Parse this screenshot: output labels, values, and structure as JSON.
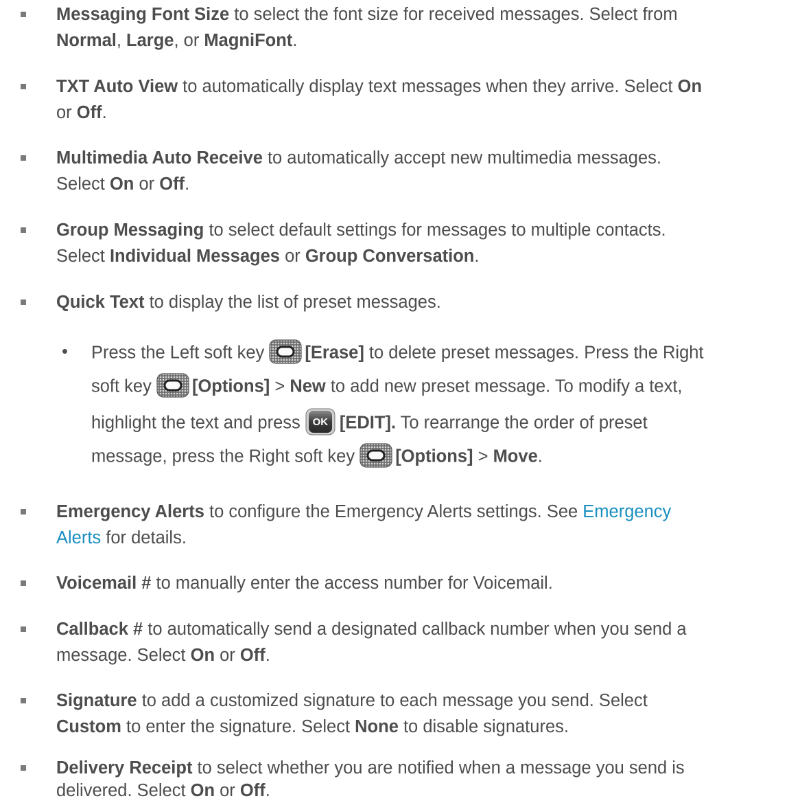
{
  "items": [
    {
      "title": "Messaging Font Size",
      "l1": " to select the font size for received messages. Select from",
      "l2a": "Normal",
      "l2b": ", ",
      "l2c": "Large",
      "l2d": ", or ",
      "l2e": "MagniFont",
      "l2f": "."
    },
    {
      "title": "TXT Auto View",
      "l1": " to automatically display text messages when they arrive. Select ",
      "l1b": "On",
      "l2a": "or ",
      "l2b": "Off",
      "l2c": "."
    },
    {
      "title": "Multimedia Auto Receive",
      "l1": " to automatically accept new multimedia messages.",
      "l2a": "Select ",
      "l2b": "On",
      "l2c": " or ",
      "l2d": "Off",
      "l2e": "."
    },
    {
      "title": "Group Messaging",
      "l1": " to select default settings for messages to multiple contacts.",
      "l2a": "Select ",
      "l2b": "Individual Messages",
      "l2c": " or ",
      "l2d": "Group Conversation",
      "l2e": "."
    },
    {
      "title": "Quick Text",
      "l1": " to display the list of preset messages."
    },
    {
      "title": "Emergency Alerts",
      "l1": " to configure the Emergency Alerts settings. See ",
      "link1": "Emergency",
      "link2": "Alerts",
      "l2": " for details."
    },
    {
      "title": "Voicemail #",
      "l1": " to manually enter the access number for Voicemail."
    },
    {
      "title": "Callback #",
      "l1": " to automatically send a designated callback number when you send a",
      "l2a": "message. Select ",
      "l2b": "On",
      "l2c": " or ",
      "l2d": "Off",
      "l2e": "."
    },
    {
      "title": "Signature",
      "l1": " to add a customized signature to each message you send. Select",
      "l2a": "Custom",
      "l2b": " to enter the signature. Select ",
      "l2c": "None",
      "l2d": " to disable signatures."
    },
    {
      "title": "Delivery Receipt",
      "l1": " to select whether you are notified when a message you send is",
      "l2a": "delivered. Select ",
      "l2b": "On",
      "l2c": " or ",
      "l2d": "Off",
      "l2e": "."
    }
  ],
  "quick_text_sub": {
    "bullet": "•",
    "s1a": "Press the Left soft key ",
    "s1b": "[Erase]",
    "s1c": " to delete preset messages. Press the Right",
    "s2a": "soft key ",
    "s2b": "[Options]",
    "s2c": " > ",
    "s2d": "New",
    "s2e": " to add new preset message. To modify a text,",
    "s3a": "highlight the text and press ",
    "s3ok": "OK",
    "s3b": "[EDIT].",
    "s3c": " To rearrange the order of preset",
    "s4a": "message, press the Right soft key ",
    "s4b": "[Options]",
    "s4c": " > ",
    "s4d": "Move",
    "s4e": "."
  },
  "icons": {
    "soft_key": "soft-key-icon",
    "ok_key": "ok-key-icon"
  }
}
